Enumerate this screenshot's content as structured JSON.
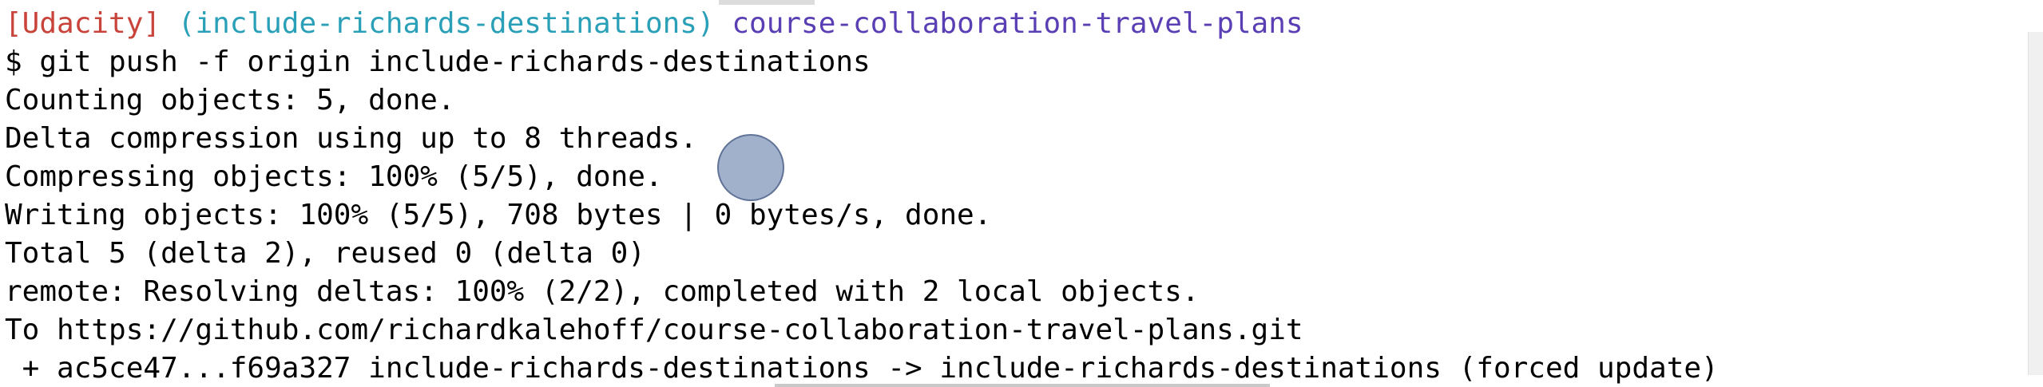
{
  "prompt": {
    "bracket": "[Udacity]",
    "branch": "(include-richards-destinations)",
    "repo": "course-collaboration-travel-plans"
  },
  "lines": [
    "$ git push -f origin include-richards-destinations",
    "Counting objects: 5, done.",
    "Delta compression using up to 8 threads.",
    "Compressing objects: 100% (5/5), done.",
    "Writing objects: 100% (5/5), 708 bytes | 0 bytes/s, done.",
    "Total 5 (delta 2), reused 0 (delta 0)",
    "remote: Resolving deltas: 100% (2/2), completed with 2 local objects.",
    "To https://github.com/richardkalehoff/course-collaboration-travel-plans.git",
    " + ac5ce47...f69a327 include-richards-destinations -> include-richards-destinations (forced update)"
  ],
  "colors": {
    "bracket": "#c8443a",
    "branch": "#2aa0b8",
    "repo": "#5a3fb4",
    "text": "#000000",
    "background": "#ffffff"
  }
}
